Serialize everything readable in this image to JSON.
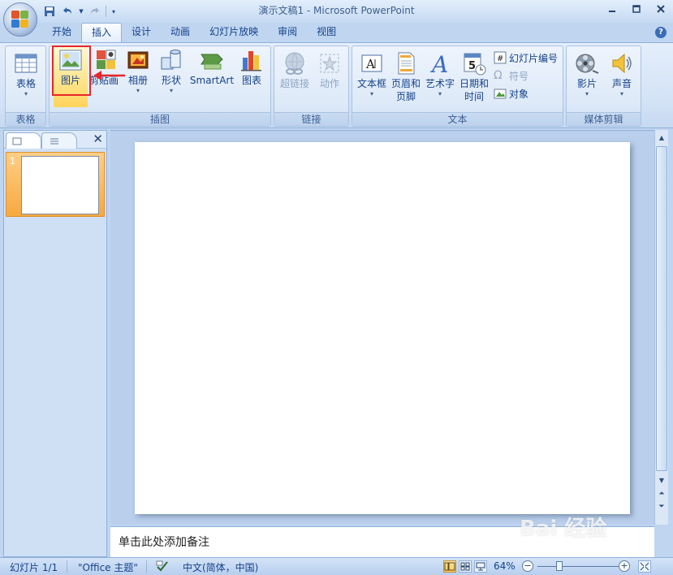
{
  "window": {
    "title": "演示文稿1 - Microsoft PowerPoint",
    "minimize_icon": "minimize-icon",
    "maximize_icon": "maximize-icon",
    "close_icon": "close-icon"
  },
  "quick_access": [
    "save-icon",
    "undo-icon",
    "redo-icon",
    "customize-icon"
  ],
  "tabs": [
    {
      "label": "开始"
    },
    {
      "label": "插入"
    },
    {
      "label": "设计"
    },
    {
      "label": "动画"
    },
    {
      "label": "幻灯片放映"
    },
    {
      "label": "审阅"
    },
    {
      "label": "视图"
    }
  ],
  "active_tab": "插入",
  "ribbon": {
    "table_group": {
      "label": "表格",
      "table_button": "表格"
    },
    "illustrations_group": {
      "label": "插图",
      "picture": "图片",
      "clipart": "剪贴画",
      "album": "相册",
      "shapes": "形状",
      "smartart": "SmartArt",
      "chart": "图表"
    },
    "links_group": {
      "label": "链接",
      "hyperlink": "超链接",
      "action": "动作"
    },
    "text_group": {
      "label": "文本",
      "textbox": "文本框",
      "header_footer_1": "页眉和",
      "header_footer_2": "页脚",
      "wordart": "艺术字",
      "datetime_1": "日期和",
      "datetime_2": "时间",
      "slide_number": "幻灯片编号",
      "symbol": "符号",
      "object": "对象"
    },
    "media_group": {
      "label": "媒体剪辑",
      "movie": "影片",
      "sound": "声音"
    }
  },
  "slides_pane": {
    "slide_number": "1"
  },
  "notes": {
    "placeholder": "单击此处添加备注"
  },
  "statusbar": {
    "slide_info": "幻灯片 1/1",
    "theme": "\"Office 主题\"",
    "language": "中文(简体，中国)",
    "zoom": "64%"
  },
  "watermark": {
    "text": "Bai 经验",
    "sub": "jingyan.baidu.com"
  },
  "colors": {
    "accent_red": "#e8262b",
    "ribbon_bg": "#d3e2f6",
    "active_thumb": "#f6a941"
  }
}
